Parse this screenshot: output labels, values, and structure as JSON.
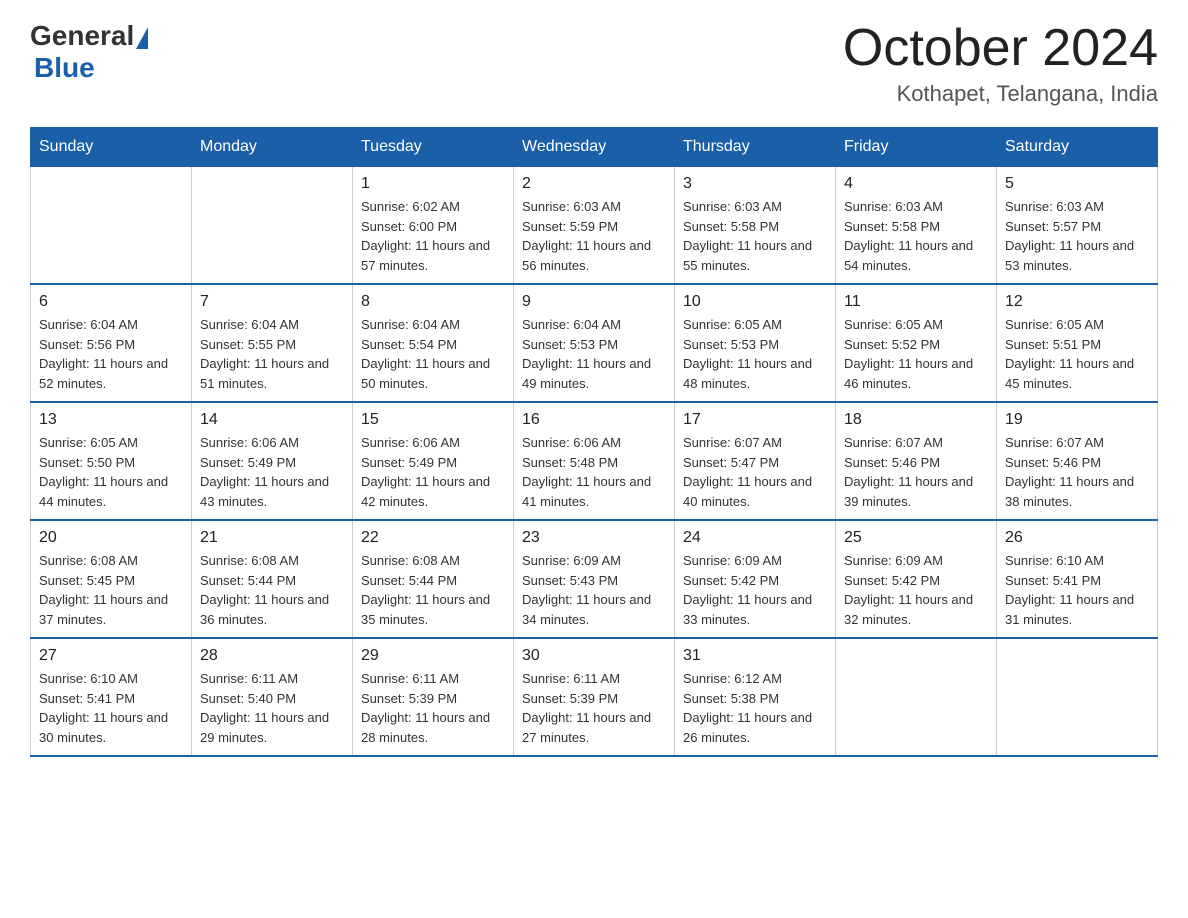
{
  "logo": {
    "general": "General",
    "blue": "Blue"
  },
  "title": "October 2024",
  "subtitle": "Kothapet, Telangana, India",
  "days_of_week": [
    "Sunday",
    "Monday",
    "Tuesday",
    "Wednesday",
    "Thursday",
    "Friday",
    "Saturday"
  ],
  "weeks": [
    [
      {
        "day": "",
        "info": ""
      },
      {
        "day": "",
        "info": ""
      },
      {
        "day": "1",
        "info": "Sunrise: 6:02 AM\nSunset: 6:00 PM\nDaylight: 11 hours and 57 minutes."
      },
      {
        "day": "2",
        "info": "Sunrise: 6:03 AM\nSunset: 5:59 PM\nDaylight: 11 hours and 56 minutes."
      },
      {
        "day": "3",
        "info": "Sunrise: 6:03 AM\nSunset: 5:58 PM\nDaylight: 11 hours and 55 minutes."
      },
      {
        "day": "4",
        "info": "Sunrise: 6:03 AM\nSunset: 5:58 PM\nDaylight: 11 hours and 54 minutes."
      },
      {
        "day": "5",
        "info": "Sunrise: 6:03 AM\nSunset: 5:57 PM\nDaylight: 11 hours and 53 minutes."
      }
    ],
    [
      {
        "day": "6",
        "info": "Sunrise: 6:04 AM\nSunset: 5:56 PM\nDaylight: 11 hours and 52 minutes."
      },
      {
        "day": "7",
        "info": "Sunrise: 6:04 AM\nSunset: 5:55 PM\nDaylight: 11 hours and 51 minutes."
      },
      {
        "day": "8",
        "info": "Sunrise: 6:04 AM\nSunset: 5:54 PM\nDaylight: 11 hours and 50 minutes."
      },
      {
        "day": "9",
        "info": "Sunrise: 6:04 AM\nSunset: 5:53 PM\nDaylight: 11 hours and 49 minutes."
      },
      {
        "day": "10",
        "info": "Sunrise: 6:05 AM\nSunset: 5:53 PM\nDaylight: 11 hours and 48 minutes."
      },
      {
        "day": "11",
        "info": "Sunrise: 6:05 AM\nSunset: 5:52 PM\nDaylight: 11 hours and 46 minutes."
      },
      {
        "day": "12",
        "info": "Sunrise: 6:05 AM\nSunset: 5:51 PM\nDaylight: 11 hours and 45 minutes."
      }
    ],
    [
      {
        "day": "13",
        "info": "Sunrise: 6:05 AM\nSunset: 5:50 PM\nDaylight: 11 hours and 44 minutes."
      },
      {
        "day": "14",
        "info": "Sunrise: 6:06 AM\nSunset: 5:49 PM\nDaylight: 11 hours and 43 minutes."
      },
      {
        "day": "15",
        "info": "Sunrise: 6:06 AM\nSunset: 5:49 PM\nDaylight: 11 hours and 42 minutes."
      },
      {
        "day": "16",
        "info": "Sunrise: 6:06 AM\nSunset: 5:48 PM\nDaylight: 11 hours and 41 minutes."
      },
      {
        "day": "17",
        "info": "Sunrise: 6:07 AM\nSunset: 5:47 PM\nDaylight: 11 hours and 40 minutes."
      },
      {
        "day": "18",
        "info": "Sunrise: 6:07 AM\nSunset: 5:46 PM\nDaylight: 11 hours and 39 minutes."
      },
      {
        "day": "19",
        "info": "Sunrise: 6:07 AM\nSunset: 5:46 PM\nDaylight: 11 hours and 38 minutes."
      }
    ],
    [
      {
        "day": "20",
        "info": "Sunrise: 6:08 AM\nSunset: 5:45 PM\nDaylight: 11 hours and 37 minutes."
      },
      {
        "day": "21",
        "info": "Sunrise: 6:08 AM\nSunset: 5:44 PM\nDaylight: 11 hours and 36 minutes."
      },
      {
        "day": "22",
        "info": "Sunrise: 6:08 AM\nSunset: 5:44 PM\nDaylight: 11 hours and 35 minutes."
      },
      {
        "day": "23",
        "info": "Sunrise: 6:09 AM\nSunset: 5:43 PM\nDaylight: 11 hours and 34 minutes."
      },
      {
        "day": "24",
        "info": "Sunrise: 6:09 AM\nSunset: 5:42 PM\nDaylight: 11 hours and 33 minutes."
      },
      {
        "day": "25",
        "info": "Sunrise: 6:09 AM\nSunset: 5:42 PM\nDaylight: 11 hours and 32 minutes."
      },
      {
        "day": "26",
        "info": "Sunrise: 6:10 AM\nSunset: 5:41 PM\nDaylight: 11 hours and 31 minutes."
      }
    ],
    [
      {
        "day": "27",
        "info": "Sunrise: 6:10 AM\nSunset: 5:41 PM\nDaylight: 11 hours and 30 minutes."
      },
      {
        "day": "28",
        "info": "Sunrise: 6:11 AM\nSunset: 5:40 PM\nDaylight: 11 hours and 29 minutes."
      },
      {
        "day": "29",
        "info": "Sunrise: 6:11 AM\nSunset: 5:39 PM\nDaylight: 11 hours and 28 minutes."
      },
      {
        "day": "30",
        "info": "Sunrise: 6:11 AM\nSunset: 5:39 PM\nDaylight: 11 hours and 27 minutes."
      },
      {
        "day": "31",
        "info": "Sunrise: 6:12 AM\nSunset: 5:38 PM\nDaylight: 11 hours and 26 minutes."
      },
      {
        "day": "",
        "info": ""
      },
      {
        "day": "",
        "info": ""
      }
    ]
  ]
}
